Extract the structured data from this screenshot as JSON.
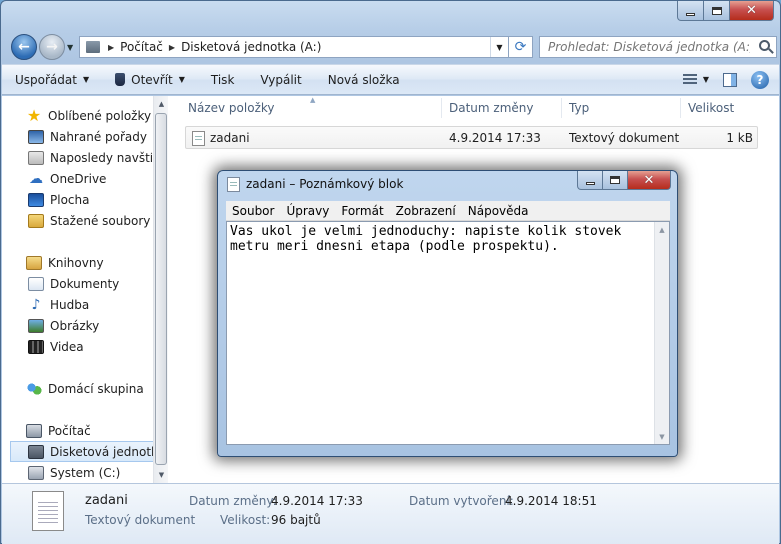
{
  "explorer": {
    "address": {
      "segments": [
        "Počítač",
        "Disketová jednotka (A:)"
      ]
    },
    "search": {
      "placeholder": "Prohledat: Disketová jednotka (A:)"
    },
    "toolbar": {
      "organize": "Uspořádat",
      "open": "Otevřít",
      "print": "Tisk",
      "burn": "Vypálit",
      "new_folder": "Nová složka"
    },
    "nav": {
      "favorites": "Oblíbené položky",
      "favorites_items": [
        "Nahrané pořady",
        "Naposledy navštíveno",
        "OneDrive",
        "Plocha",
        "Stažené soubory"
      ],
      "libraries": "Knihovny",
      "library_items": [
        "Dokumenty",
        "Hudba",
        "Obrázky",
        "Videa"
      ],
      "homegroup": "Domácí skupina",
      "computer": "Počítač",
      "computer_items": [
        "Disketová jednotka (A:)",
        "System (C:)"
      ]
    },
    "columns": {
      "name": "Název položky",
      "date": "Datum změny",
      "type": "Typ",
      "size": "Velikost"
    },
    "files": [
      {
        "name": "zadani",
        "date": "4.9.2014 17:33",
        "type": "Textový dokument",
        "size": "1 kB"
      }
    ],
    "details": {
      "name": "zadani",
      "type": "Textový dokument",
      "modified_label": "Datum změny:",
      "modified": "4.9.2014 17:33",
      "created_label": "Datum vytvoření:",
      "created": "4.9.2014 18:51",
      "size_label": "Velikost:",
      "size": "96 bajtů"
    }
  },
  "notepad": {
    "title": "zadani – Poznámkový blok",
    "menu": [
      "Soubor",
      "Úpravy",
      "Formát",
      "Zobrazení",
      "Nápověda"
    ],
    "text": "Vas ukol je velmi jednoduchy: napiste kolik stovek\nmetru meri dnesni etapa (podle prospektu)."
  }
}
